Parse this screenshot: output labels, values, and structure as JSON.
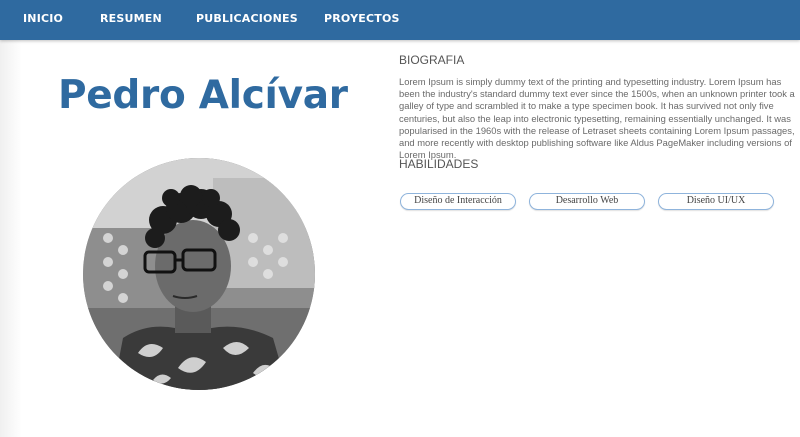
{
  "nav": {
    "items": [
      {
        "label": "INICIO"
      },
      {
        "label": "RESUMEN"
      },
      {
        "label": "PUBLICACIONES"
      },
      {
        "label": "PROYECTOS"
      }
    ],
    "background": "#2f6aa0"
  },
  "profile": {
    "name": "Pedro Alcívar",
    "name_color": "#2f6aa0"
  },
  "biography": {
    "title": "BIOGRAFIA",
    "text": "Lorem Ipsum is simply dummy text of the printing and typesetting industry. Lorem Ipsum has been the industry's standard dummy text ever since the 1500s, when an unknown printer took a galley of type and scrambled it to make a type specimen book. It has survived not only five centuries, but also the leap into electronic typesetting, remaining essentially unchanged. It was popularised in the 1960s with the release of Letraset sheets containing Lorem Ipsum passages, and more recently with desktop publishing software like Aldus PageMaker including versions of Lorem Ipsum."
  },
  "skills": {
    "title": "HABILIDADES",
    "items": [
      {
        "label": "Diseño de Interacción"
      },
      {
        "label": "Desarrollo Web"
      },
      {
        "label": "Diseño UI/UX"
      }
    ],
    "border_color": "#8fb4dc"
  }
}
